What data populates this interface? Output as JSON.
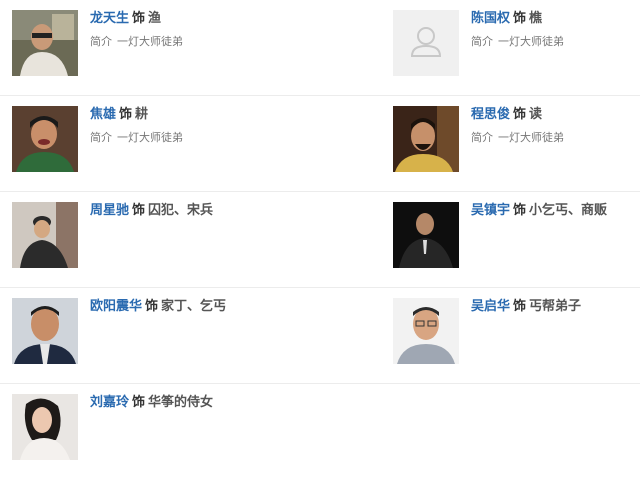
{
  "cast": [
    {
      "left": {
        "actor": "龙天生",
        "as": "饰",
        "role": "渔",
        "intro_label": "简介",
        "intro": "一灯大师徒弟"
      },
      "right": {
        "actor": "陈国权",
        "as": "饰",
        "role": "樵",
        "intro_label": "简介",
        "intro": "一灯大师徒弟"
      }
    },
    {
      "left": {
        "actor": "焦雄",
        "as": "饰",
        "role": "耕",
        "intro_label": "简介",
        "intro": "一灯大师徒弟"
      },
      "right": {
        "actor": "程思俊",
        "as": "饰",
        "role": "读",
        "intro_label": "简介",
        "intro": "一灯大师徒弟"
      }
    },
    {
      "left": {
        "actor": "周星驰",
        "as": "饰",
        "role": "囚犯、宋兵"
      },
      "right": {
        "actor": "吴镇宇",
        "as": "饰",
        "role": "小乞丐、商贩"
      }
    },
    {
      "left": {
        "actor": "欧阳震华",
        "as": "饰",
        "role": "家丁、乞丐"
      },
      "right": {
        "actor": "吴启华",
        "as": "饰",
        "role": "丐帮弟子"
      }
    },
    {
      "left": {
        "actor": "刘嘉玲",
        "as": "饰",
        "role": "华筝的侍女"
      }
    }
  ],
  "photos": {
    "placeholder_icon": "person-placeholder-icon"
  }
}
